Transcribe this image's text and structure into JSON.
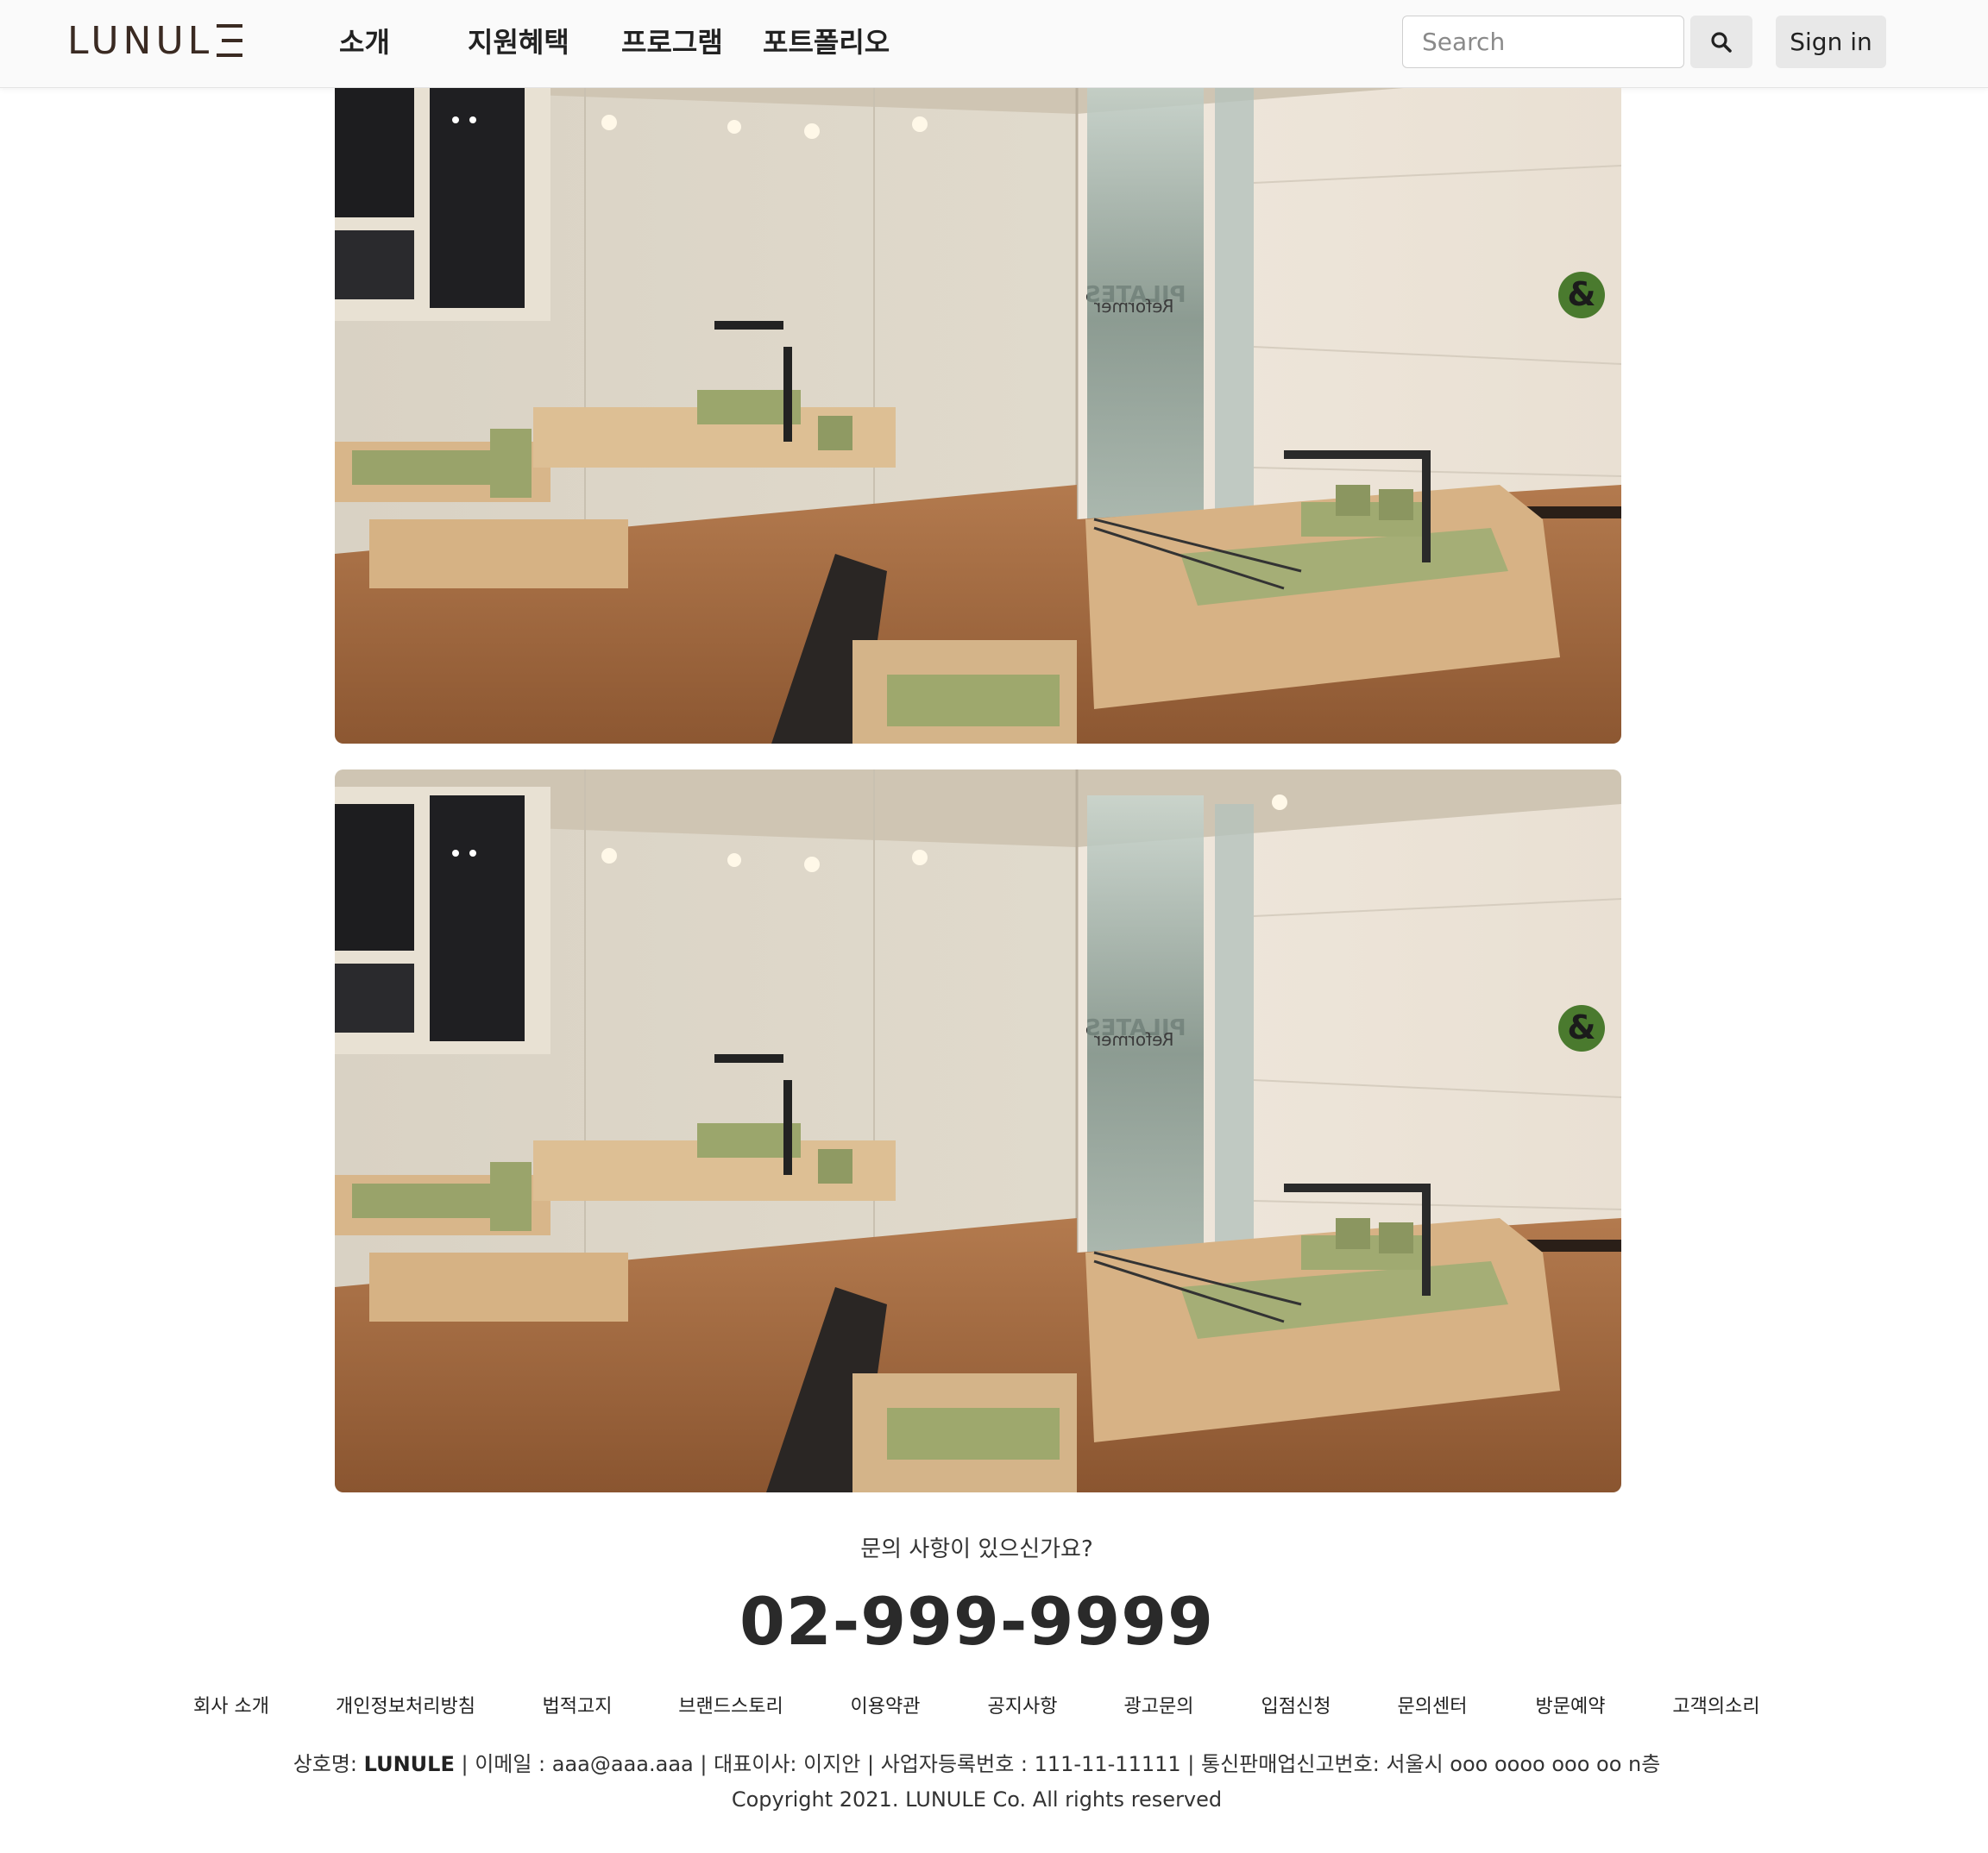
{
  "header": {
    "logo": "LUNULE",
    "nav": [
      "소개",
      "지원혜택",
      "프로그램",
      "포트폴리오"
    ],
    "search_placeholder": "Search",
    "sign_in": "Sign in"
  },
  "photos": [
    {
      "mirror_text": "PILATES",
      "door_text": "Reformer",
      "sign": "&"
    },
    {
      "mirror_text": "PILATES",
      "door_text": "Reformer",
      "sign": "&"
    }
  ],
  "contact": {
    "question": "문의 사항이 있으신가요?",
    "phone": "02-999-9999"
  },
  "footer": {
    "links": [
      "회사 소개",
      "개인정보처리방침",
      "법적고지",
      "브랜드스토리",
      "이용약관",
      "공지사항",
      "광고문의",
      "입점신청",
      "문의센터",
      "방문예약",
      "고객의소리"
    ],
    "company_label": "상호명: ",
    "company_name": "LUNULE",
    "info_rest": " | 이메일 : aaa@aaa.aaa | 대표이사: 이지안 | 사업자등록번호 : 111-11-11111 | 통신판매업신고번호: 서울시 ooo oooo ooo oo n층",
    "copyright": "Copyright 2021. LUNULE Co. All rights reserved"
  }
}
